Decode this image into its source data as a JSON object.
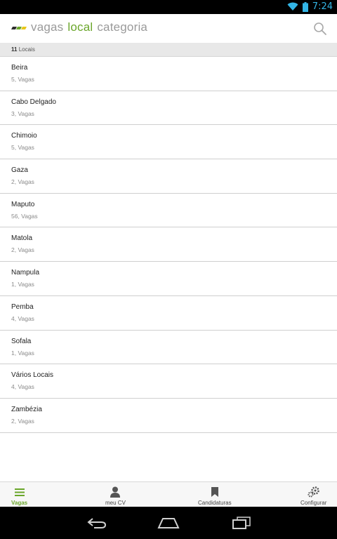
{
  "status_bar": {
    "time": "7:24"
  },
  "app_bar": {
    "tabs": [
      {
        "label": "vagas",
        "active": false
      },
      {
        "label": "local",
        "active": true
      },
      {
        "label": "categoria",
        "active": false
      }
    ],
    "accent_color": "#6aa62a",
    "icons": [
      "logo-icon",
      "search-icon"
    ]
  },
  "count_bar": {
    "count": "11",
    "label": " Locais"
  },
  "locations": [
    {
      "name": "Beira",
      "count": "5, Vagas"
    },
    {
      "name": "Cabo Delgado",
      "count": "3, Vagas"
    },
    {
      "name": "Chimoio",
      "count": "5, Vagas"
    },
    {
      "name": "Gaza",
      "count": "2, Vagas"
    },
    {
      "name": "Maputo",
      "count": "56, Vagas"
    },
    {
      "name": "Matola",
      "count": "2, Vagas"
    },
    {
      "name": "Nampula",
      "count": "1, Vagas"
    },
    {
      "name": "Pemba",
      "count": "4, Vagas"
    },
    {
      "name": "Sofala",
      "count": "1, Vagas"
    },
    {
      "name": "Vários Locais",
      "count": "4, Vagas"
    },
    {
      "name": "Zambézia",
      "count": "2, Vagas"
    }
  ],
  "bottom_nav": [
    {
      "label": "Vagas",
      "icon": "menu-icon",
      "active": true
    },
    {
      "label": "meu CV",
      "icon": "person-icon",
      "active": false
    },
    {
      "label": "Candidaturas",
      "icon": "bookmark-icon",
      "active": false
    },
    {
      "label": "Configurar",
      "icon": "gears-icon",
      "active": false
    }
  ]
}
